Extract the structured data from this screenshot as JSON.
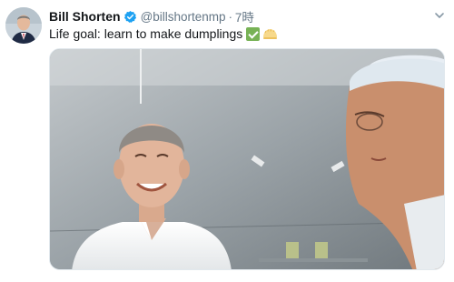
{
  "tweet": {
    "author": {
      "name": "Bill Shorten",
      "handle": "@billshortenmp",
      "verified": true,
      "avatar": "avatar-photo"
    },
    "separator": "·",
    "time": "7時",
    "text": "Life goal: learn to make dumplings",
    "emojis": [
      "check-mark-emoji",
      "dumpling-emoji"
    ],
    "media": {
      "type": "photo",
      "description_icon": "photo"
    },
    "menu_icon": "chevron-down-icon"
  },
  "colors": {
    "verified_badge": "#1da1f2",
    "handle_gray": "#657786",
    "check_green": "#77b255"
  }
}
